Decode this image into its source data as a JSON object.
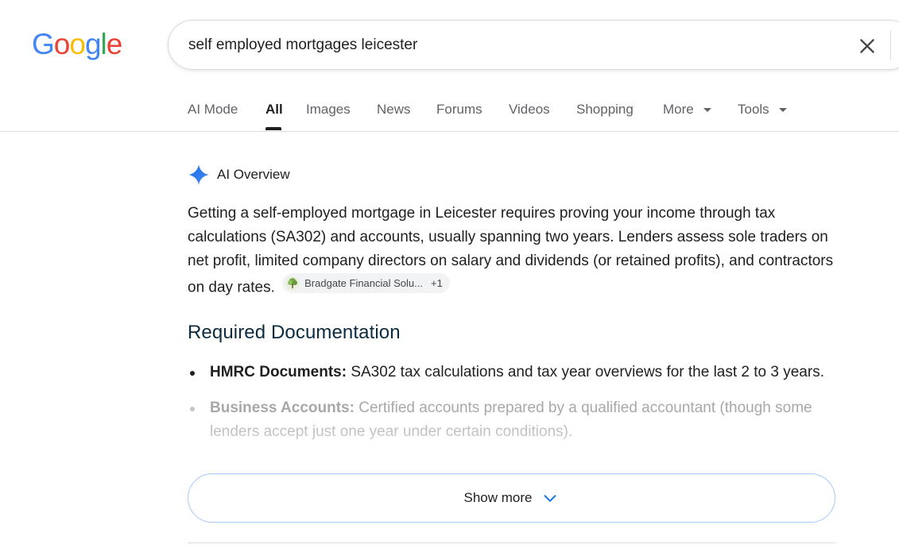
{
  "header": {
    "logo_letters": [
      {
        "ch": "G",
        "color": "#4285F4"
      },
      {
        "ch": "o",
        "color": "#EA4335"
      },
      {
        "ch": "o",
        "color": "#FBBC05"
      },
      {
        "ch": "g",
        "color": "#4285F4"
      },
      {
        "ch": "l",
        "color": "#34A853"
      },
      {
        "ch": "e",
        "color": "#EA4335"
      }
    ],
    "search_value": "self employed mortgages leicester",
    "clear_icon": "close-icon"
  },
  "tabs": [
    {
      "label": "AI Mode"
    },
    {
      "label": "All",
      "active": true
    },
    {
      "label": "Images"
    },
    {
      "label": "News"
    },
    {
      "label": "Forums"
    },
    {
      "label": "Videos"
    },
    {
      "label": "Shopping"
    },
    {
      "label": "More",
      "dropdown": true
    },
    {
      "label": "Tools",
      "dropdown": true
    }
  ],
  "ai_overview": {
    "title": "AI Overview",
    "summary": "Getting a self-employed mortgage in Leicester requires proving your income through tax calculations (SA302) and accounts, usually spanning two years. Lenders assess sole traders on net profit, limited company directors on salary and dividends (or retained profits), and contractors on day rates.",
    "source_chip": {
      "label": "Bradgate Financial Solu...",
      "more": "+1"
    },
    "section_heading": "Required Documentation",
    "items": [
      {
        "bold": "HMRC Documents:",
        "text": " SA302 tax calculations and tax year overviews for the last 2 to 3 years."
      },
      {
        "bold": "Business Accounts:",
        "text": " Certified accounts prepared by a qualified accountant (though some lenders accept just one year under certain conditions)."
      }
    ],
    "show_more_label": "Show more"
  },
  "colors": {
    "accent_border": "#a8c7fa",
    "spark_blue": "#4285F4"
  }
}
